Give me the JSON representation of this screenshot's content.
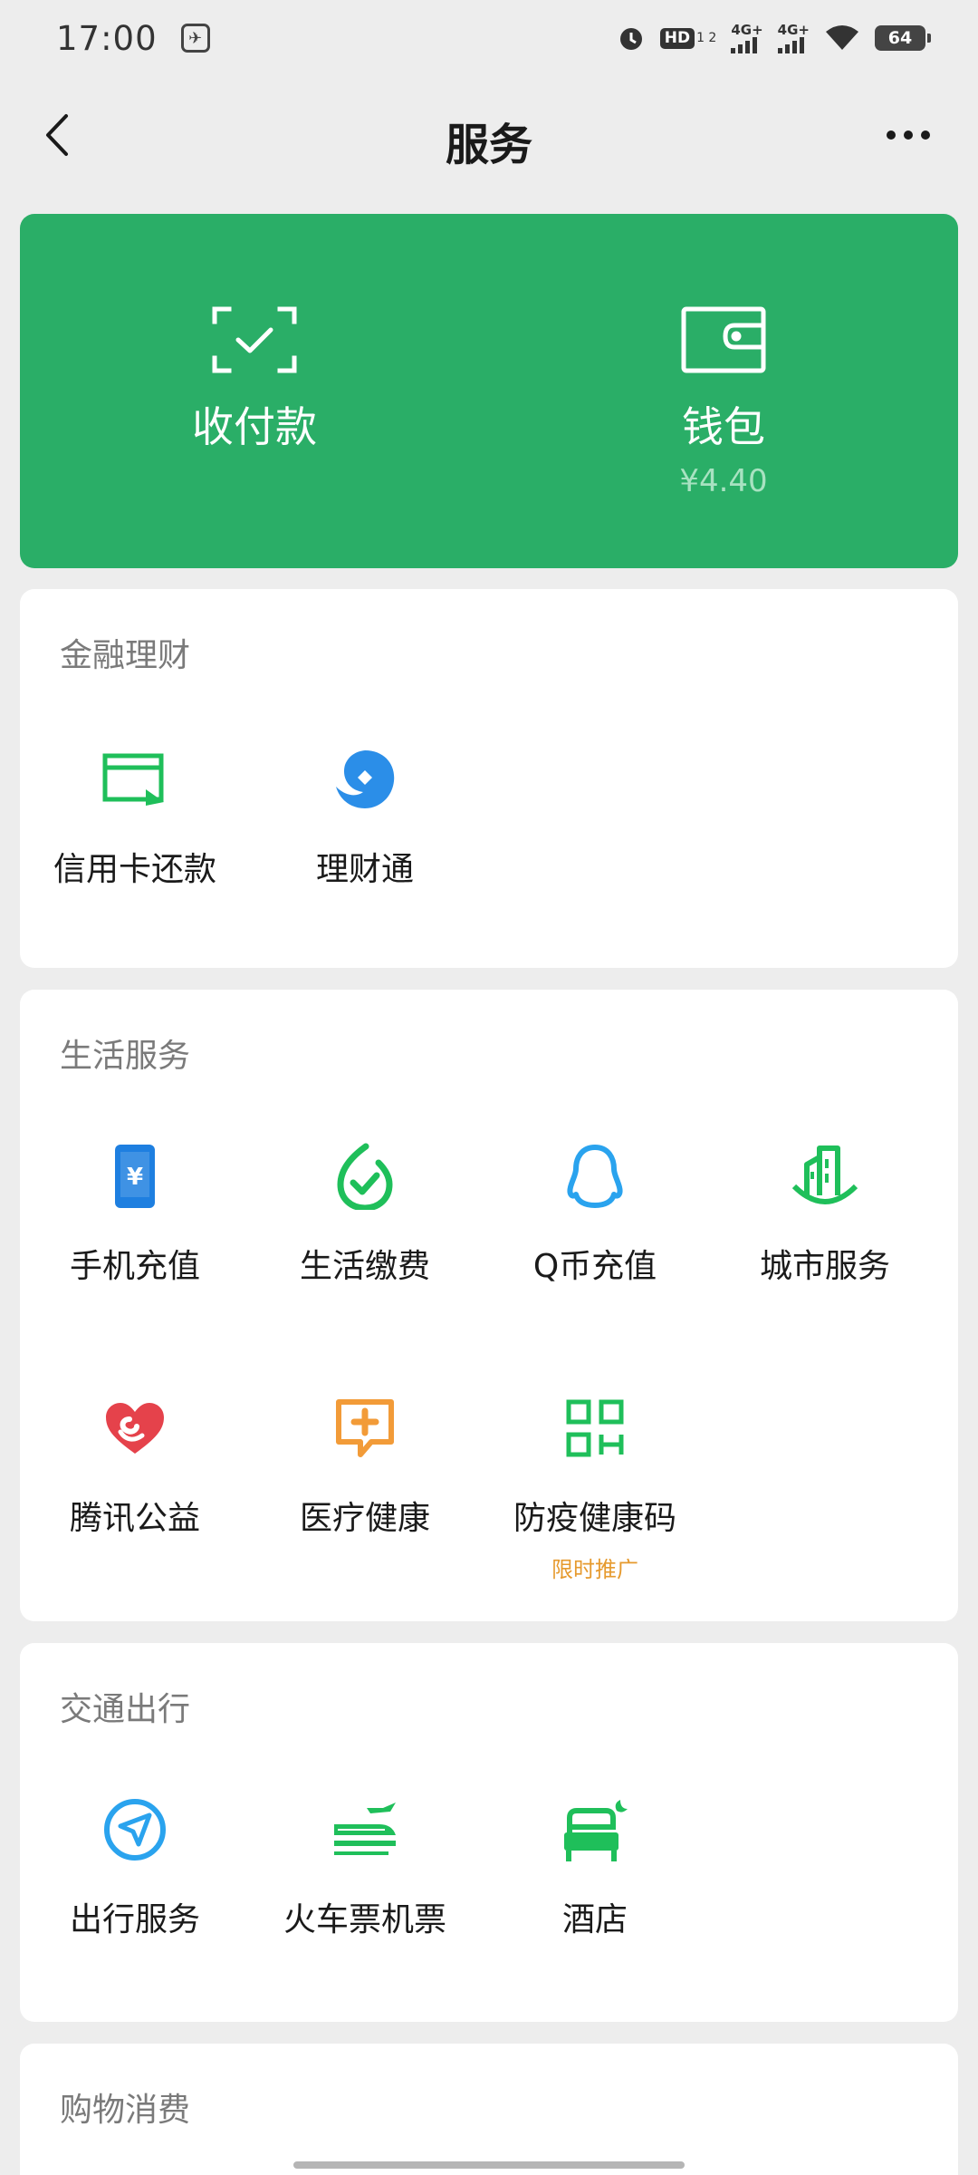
{
  "status_bar": {
    "time": "17:00",
    "hd_badge": "HD",
    "hd_sub": "1 2",
    "signal1_label": "4G+",
    "signal2_label": "4G+",
    "battery": "64",
    "icons": [
      "alarm-icon",
      "hd-icon",
      "signal-icon",
      "signal-icon",
      "wifi-icon",
      "battery-icon"
    ]
  },
  "nav": {
    "title": "服务",
    "back_icon": "chevron-left-icon",
    "more_icon": "more-icon"
  },
  "wallet_card": {
    "background": "#2aae67",
    "pay": {
      "label": "收付款",
      "icon": "scan-check-icon"
    },
    "wallet": {
      "label": "钱包",
      "balance": "¥4.40",
      "icon": "wallet-icon"
    }
  },
  "sections": {
    "finance": {
      "title": "金融理财",
      "items": [
        {
          "label": "信用卡还款",
          "icon": "credit-card-icon",
          "color": "#1fbf5a"
        },
        {
          "label": "理财通",
          "icon": "wealth-icon",
          "color": "#2b8ee8"
        }
      ]
    },
    "life": {
      "title": "生活服务",
      "items": [
        {
          "label": "手机充值",
          "icon": "phone-topup-icon",
          "color": "#1e7fe0"
        },
        {
          "label": "生活缴费",
          "icon": "utility-bill-icon",
          "color": "#1fbf5a"
        },
        {
          "label": "Q币充值",
          "icon": "qq-penguin-icon",
          "color": "#2aa3ee"
        },
        {
          "label": "城市服务",
          "icon": "city-building-icon",
          "color": "#1fbf5a"
        },
        {
          "label": "腾讯公益",
          "icon": "charity-heart-icon",
          "color": "#e5424b"
        },
        {
          "label": "医疗健康",
          "icon": "medical-chat-icon",
          "color": "#f29b38"
        },
        {
          "label": "防疫健康码",
          "icon": "qr-code-icon",
          "color": "#1fbf5a",
          "sub": "限时推广"
        }
      ]
    },
    "travel": {
      "title": "交通出行",
      "items": [
        {
          "label": "出行服务",
          "icon": "navigation-icon",
          "color": "#2aa3ee"
        },
        {
          "label": "火车票机票",
          "icon": "train-plane-icon",
          "color": "#1fbf5a"
        },
        {
          "label": "酒店",
          "icon": "hotel-bed-icon",
          "color": "#1fbf5a"
        }
      ]
    },
    "shopping": {
      "title": "购物消费"
    }
  }
}
